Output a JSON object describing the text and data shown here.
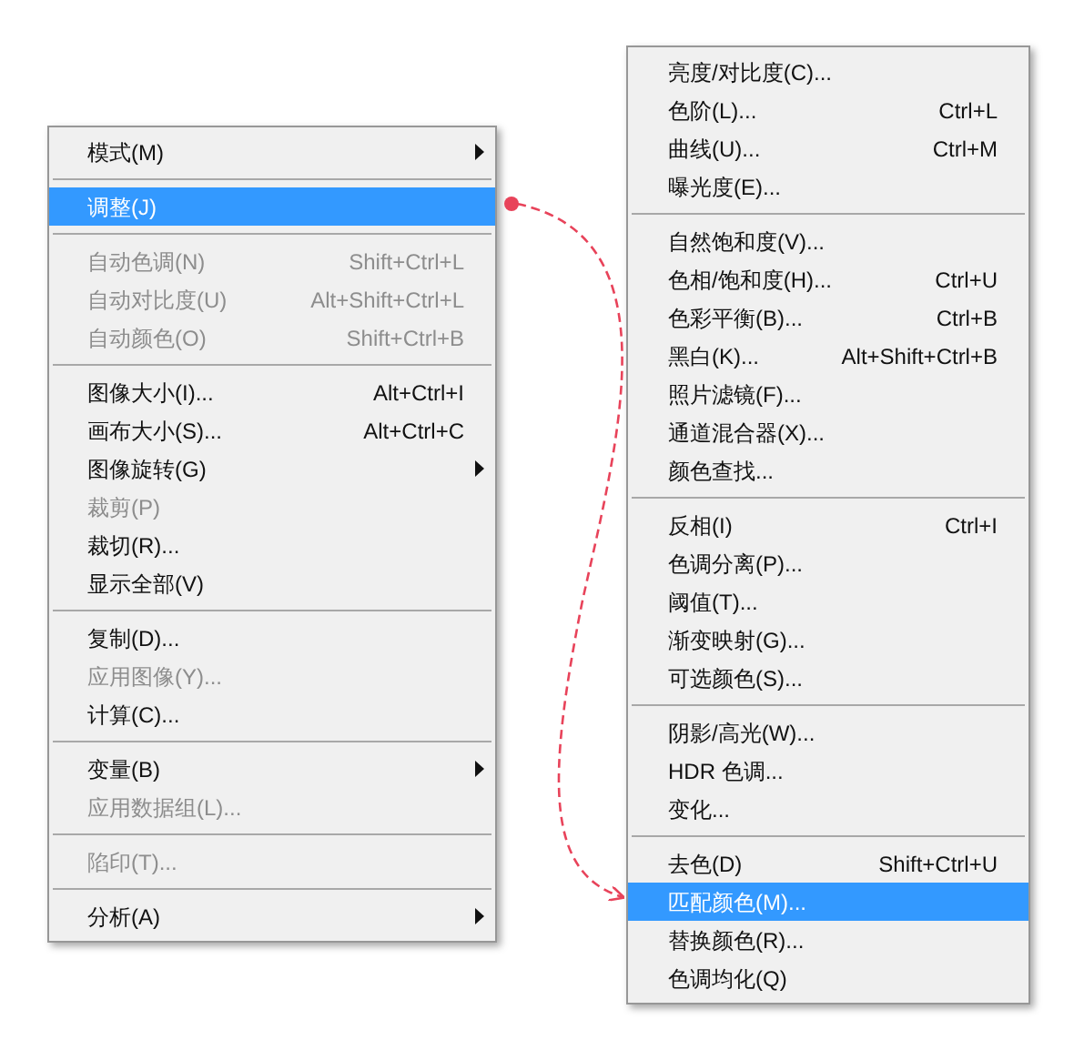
{
  "menus": [
    {
      "sections": [
        [
          {
            "label": "模式(M)",
            "submenu": true,
            "disabled": false,
            "selected": false
          }
        ],
        [
          {
            "label": "调整(J)",
            "submenu": false,
            "disabled": false,
            "selected": true
          }
        ],
        [
          {
            "label": "自动色调(N)",
            "shortcut": "Shift+Ctrl+L",
            "submenu": false,
            "disabled": true,
            "selected": false
          },
          {
            "label": "自动对比度(U)",
            "shortcut": "Alt+Shift+Ctrl+L",
            "submenu": false,
            "disabled": true,
            "selected": false
          },
          {
            "label": "自动颜色(O)",
            "shortcut": "Shift+Ctrl+B",
            "submenu": false,
            "disabled": true,
            "selected": false
          }
        ],
        [
          {
            "label": "图像大小(I)...",
            "shortcut": "Alt+Ctrl+I",
            "submenu": false,
            "disabled": false,
            "selected": false
          },
          {
            "label": "画布大小(S)...",
            "shortcut": "Alt+Ctrl+C",
            "submenu": false,
            "disabled": false,
            "selected": false
          },
          {
            "label": "图像旋转(G)",
            "submenu": true,
            "disabled": false,
            "selected": false
          },
          {
            "label": "裁剪(P)",
            "submenu": false,
            "disabled": true,
            "selected": false
          },
          {
            "label": "裁切(R)...",
            "submenu": false,
            "disabled": false,
            "selected": false
          },
          {
            "label": "显示全部(V)",
            "submenu": false,
            "disabled": false,
            "selected": false
          }
        ],
        [
          {
            "label": "复制(D)...",
            "submenu": false,
            "disabled": false,
            "selected": false
          },
          {
            "label": "应用图像(Y)...",
            "submenu": false,
            "disabled": true,
            "selected": false
          },
          {
            "label": "计算(C)...",
            "submenu": false,
            "disabled": false,
            "selected": false
          }
        ],
        [
          {
            "label": "变量(B)",
            "submenu": true,
            "disabled": false,
            "selected": false
          },
          {
            "label": "应用数据组(L)...",
            "submenu": false,
            "disabled": true,
            "selected": false
          }
        ],
        [
          {
            "label": "陷印(T)...",
            "submenu": false,
            "disabled": true,
            "selected": false
          }
        ],
        [
          {
            "label": "分析(A)",
            "submenu": true,
            "disabled": false,
            "selected": false
          }
        ]
      ]
    },
    {
      "sections": [
        [
          {
            "label": "亮度/对比度(C)...",
            "submenu": false,
            "disabled": false,
            "selected": false
          },
          {
            "label": "色阶(L)...",
            "shortcut": "Ctrl+L",
            "submenu": false,
            "disabled": false,
            "selected": false
          },
          {
            "label": "曲线(U)...",
            "shortcut": "Ctrl+M",
            "submenu": false,
            "disabled": false,
            "selected": false
          },
          {
            "label": "曝光度(E)...",
            "submenu": false,
            "disabled": false,
            "selected": false
          }
        ],
        [
          {
            "label": "自然饱和度(V)...",
            "submenu": false,
            "disabled": false,
            "selected": false
          },
          {
            "label": "色相/饱和度(H)...",
            "shortcut": "Ctrl+U",
            "submenu": false,
            "disabled": false,
            "selected": false
          },
          {
            "label": "色彩平衡(B)...",
            "shortcut": "Ctrl+B",
            "submenu": false,
            "disabled": false,
            "selected": false
          },
          {
            "label": "黑白(K)...",
            "shortcut": "Alt+Shift+Ctrl+B",
            "submenu": false,
            "disabled": false,
            "selected": false
          },
          {
            "label": "照片滤镜(F)...",
            "submenu": false,
            "disabled": false,
            "selected": false
          },
          {
            "label": "通道混合器(X)...",
            "submenu": false,
            "disabled": false,
            "selected": false
          },
          {
            "label": "颜色查找...",
            "submenu": false,
            "disabled": false,
            "selected": false
          }
        ],
        [
          {
            "label": "反相(I)",
            "shortcut": "Ctrl+I",
            "submenu": false,
            "disabled": false,
            "selected": false
          },
          {
            "label": "色调分离(P)...",
            "submenu": false,
            "disabled": false,
            "selected": false
          },
          {
            "label": "阈值(T)...",
            "submenu": false,
            "disabled": false,
            "selected": false
          },
          {
            "label": "渐变映射(G)...",
            "submenu": false,
            "disabled": false,
            "selected": false
          },
          {
            "label": "可选颜色(S)...",
            "submenu": false,
            "disabled": false,
            "selected": false
          }
        ],
        [
          {
            "label": "阴影/高光(W)...",
            "submenu": false,
            "disabled": false,
            "selected": false
          },
          {
            "label": "HDR 色调...",
            "submenu": false,
            "disabled": false,
            "selected": false
          },
          {
            "label": "变化...",
            "submenu": false,
            "disabled": false,
            "selected": false
          }
        ],
        [
          {
            "label": "去色(D)",
            "shortcut": "Shift+Ctrl+U",
            "submenu": false,
            "disabled": false,
            "selected": false
          },
          {
            "label": "匹配颜色(M)...",
            "submenu": false,
            "disabled": false,
            "selected": true
          },
          {
            "label": "替换颜色(R)...",
            "submenu": false,
            "disabled": false,
            "selected": false
          },
          {
            "label": "色调均化(Q)",
            "submenu": false,
            "disabled": false,
            "selected": false
          }
        ]
      ]
    }
  ]
}
